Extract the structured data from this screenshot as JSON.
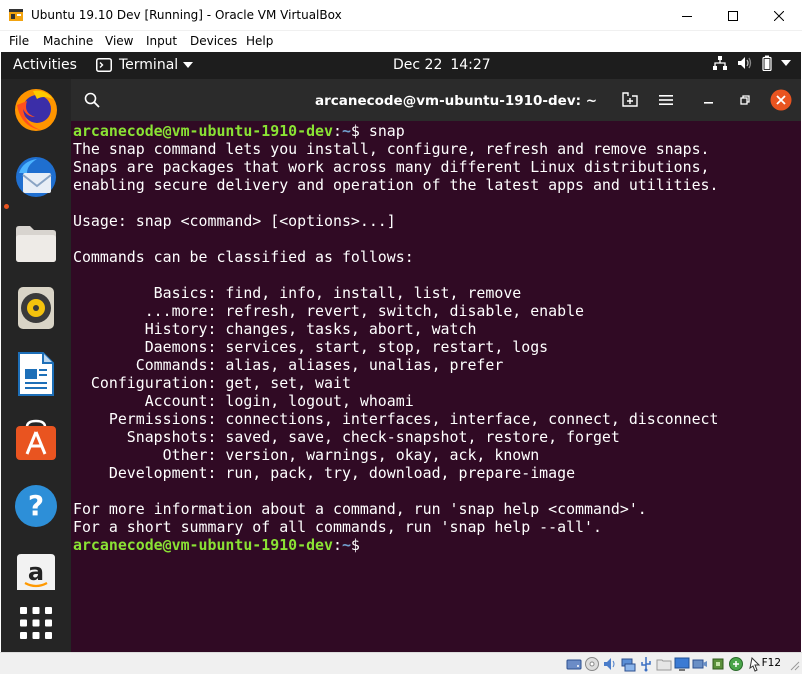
{
  "vbox": {
    "title": "Ubuntu 19.10 Dev [Running] - Oracle VM VirtualBox",
    "menu": [
      "File",
      "Machine",
      "View",
      "Input",
      "Devices",
      "Help"
    ],
    "host_key": "F12"
  },
  "topbar": {
    "activities": "Activities",
    "app_name": "Terminal",
    "date": "Dec 22",
    "time": "14:27"
  },
  "dock": {
    "items": [
      "firefox-icon",
      "thunderbird-icon",
      "files-icon",
      "rhythmbox-icon",
      "libreoffice-writer-icon",
      "ubuntu-software-icon",
      "help-icon",
      "amazon-icon",
      "show-applications-icon"
    ]
  },
  "terminal": {
    "title": "arcanecode@vm-ubuntu-1910-dev: ~",
    "prompt_user": "arcanecode@vm-ubuntu-1910-dev",
    "prompt_path": "~",
    "prompt_symbol": "$ ",
    "command": "snap",
    "output": [
      "The snap command lets you install, configure, refresh and remove snaps.",
      "Snaps are packages that work across many different Linux distributions,",
      "enabling secure delivery and operation of the latest apps and utilities.",
      "",
      "Usage: snap <command> [<options>...]",
      "",
      "Commands can be classified as follows:",
      "",
      "         Basics: find, info, install, list, remove",
      "        ...more: refresh, revert, switch, disable, enable",
      "        History: changes, tasks, abort, watch",
      "        Daemons: services, start, stop, restart, logs",
      "       Commands: alias, aliases, unalias, prefer",
      "  Configuration: get, set, wait",
      "        Account: login, logout, whoami",
      "    Permissions: connections, interfaces, interface, connect, disconnect",
      "      Snapshots: saved, save, check-snapshot, restore, forget",
      "          Other: version, warnings, okay, ack, known",
      "    Development: run, pack, try, download, prepare-image",
      "",
      "For more information about a command, run 'snap help <command>'.",
      "For a short summary of all commands, run 'snap help --all'."
    ]
  }
}
